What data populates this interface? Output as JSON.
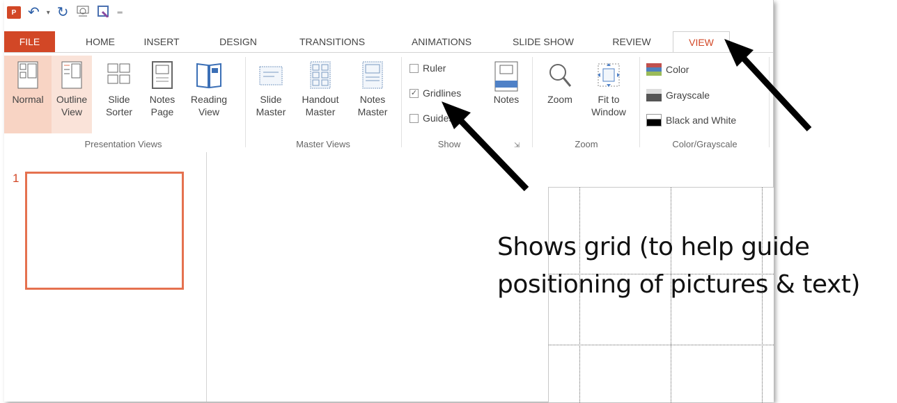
{
  "quick_access": {
    "logo": "P",
    "icons": [
      "undo-icon",
      "redo-icon",
      "start-from-beginning-icon",
      "touch-mode-icon",
      "customize-icon"
    ]
  },
  "tabs": [
    "FILE",
    "HOME",
    "INSERT",
    "DESIGN",
    "TRANSITIONS",
    "ANIMATIONS",
    "SLIDE SHOW",
    "REVIEW",
    "VIEW"
  ],
  "active_tab": "VIEW",
  "ribbon": {
    "presentation_views": {
      "label": "Presentation Views",
      "buttons": [
        {
          "line1": "Normal",
          "line2": ""
        },
        {
          "line1": "Outline",
          "line2": "View"
        },
        {
          "line1": "Slide",
          "line2": "Sorter"
        },
        {
          "line1": "Notes",
          "line2": "Page"
        },
        {
          "line1": "Reading",
          "line2": "View"
        }
      ]
    },
    "master_views": {
      "label": "Master Views",
      "buttons": [
        {
          "line1": "Slide",
          "line2": "Master"
        },
        {
          "line1": "Handout",
          "line2": "Master"
        },
        {
          "line1": "Notes",
          "line2": "Master"
        }
      ]
    },
    "show": {
      "label": "Show",
      "ruler": {
        "label": "Ruler",
        "checked": false
      },
      "gridlines": {
        "label": "Gridlines",
        "checked": true
      },
      "guides": {
        "label": "Guides",
        "checked": false
      },
      "notes_label": "Notes"
    },
    "zoom": {
      "label": "Zoom",
      "zoom_btn": "Zoom",
      "fit_line1": "Fit to",
      "fit_line2": "Window"
    },
    "color_grayscale": {
      "label": "Color/Grayscale",
      "color": "Color",
      "grayscale": "Grayscale",
      "bw": "Black and White"
    }
  },
  "slides_panel": {
    "slide_number": "1"
  },
  "annotation": {
    "line1": "Shows grid (to help guide",
    "line2": "positioning of pictures & text)"
  },
  "colors": {
    "accent": "#d24726",
    "thumb_border": "#e5714f",
    "highlight": "#f8d4c4"
  }
}
